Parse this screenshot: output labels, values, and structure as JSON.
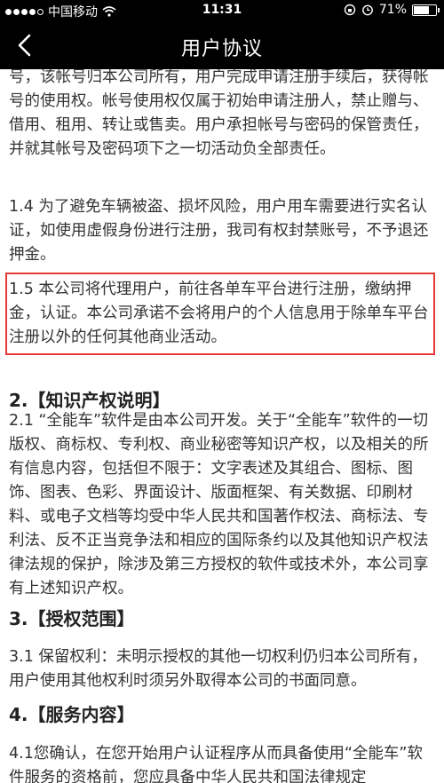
{
  "status_bar": {
    "carrier": "中国移动",
    "time": "11:31",
    "battery": "71%",
    "battery_level": 0.71
  },
  "nav": {
    "title": "用户协议"
  },
  "content": {
    "p_top": "号，该帐号归本公司所有，用户完成申请注册手续后，获得帐号的使用权。帐号使用权仅属于初始申请注册人，禁止赠与、借用、租用、转让或售卖。用户承担帐号与密码的保管责任，并就其帐号及密码项下之一切活动负全部责任。",
    "p_1_4": "1.4  为了避免车辆被盗、损坏风险，用户用车需要进行实名认证，如使用虚假身份进行注册，我司有权封禁账号，不予退还押金。",
    "p_1_5": "1.5 本公司将代理用户，前往各单车平台进行注册，缴纳押金，认证。本公司承诺不会将用户的个人信息用于除单车平台注册以外的任何其他商业活动。",
    "h2": "2.【知识产权说明】",
    "p_2_1": "2.1 “全能车”软件是由本公司开发。关于“全能车”软件的一切版权、商标权、专利权、商业秘密等知识产权，以及相关的所有信息内容，包括但不限于：文字表述及其组合、图标、图饰、图表、色彩、界面设计、版面框架、有关数据、印刷材料、或电子文档等均受中华人民共和国著作权法、商标法、专利法、反不正当竞争法和相应的国际条约以及其他知识产权法律法规的保护，除涉及第三方授权的软件或技术外，本公司享有上述知识产权。",
    "h3": "3.【授权范围】",
    "p_3_1": "3.1 保留权利：未明示授权的其他一切权利仍归本公司所有，用户使用其他权利时须另外取得本公司的书面同意。",
    "h4": "4.【服务内容】",
    "p_4_1": "4.1您确认，在您开始用户认证程序从而具备使用“全能车”软件服务的资格前，您应具备中华人民共和国法律规定"
  }
}
